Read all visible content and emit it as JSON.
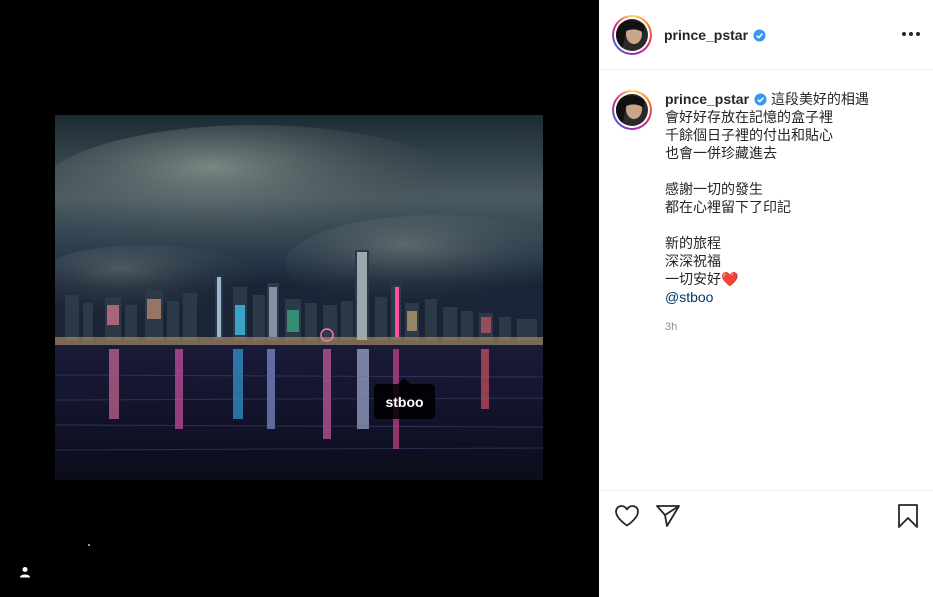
{
  "post": {
    "username": "prince_pstar",
    "photo_tag": "stboo",
    "caption_lines": [
      "這段美好的相遇",
      "會好好存放在記憶的盒子裡",
      "千餘個日子裡的付出和貼心",
      "也會一併珍藏進去",
      "",
      "感謝一切的發生",
      "都在心裡留下了印記",
      "",
      "新的旅程",
      "深深祝福",
      "一切安好"
    ],
    "caption_emoji": "❤️",
    "mention": "@stboo",
    "time": "3h"
  },
  "icons": {
    "verified": "verified-badge-icon",
    "more": "more-options-icon",
    "tags": "user-tags-icon",
    "like": "heart-icon",
    "share": "paper-plane-icon",
    "save": "bookmark-icon"
  },
  "colors": {
    "verified_blue": "#3897f0",
    "mention": "#00376b",
    "muted": "#8e8e8e",
    "background_media": "#000000"
  }
}
